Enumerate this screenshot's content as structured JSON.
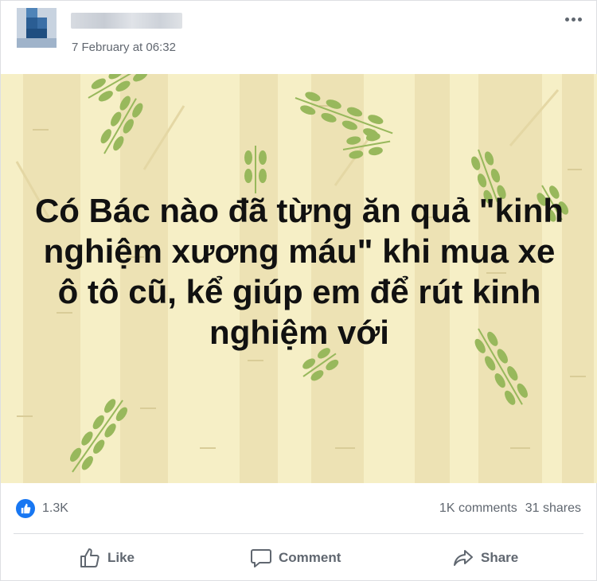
{
  "post": {
    "timestamp": "7 February at 06:32",
    "text": "Có Bác nào đã từng ăn quả \"kinh nghiệm xương máu\" khi mua xe ô tô cũ, kể giúp em để rút kinh nghiệm với",
    "background_color": "#f6efc6"
  },
  "stats": {
    "reactions": "1.3K",
    "comments": "1K comments",
    "shares": "31 shares",
    "reaction_color": "#1877f2"
  },
  "actions": {
    "like_label": "Like",
    "comment_label": "Comment",
    "share_label": "Share"
  },
  "icons": {
    "more": "more-horizontal-icon",
    "like_reaction": "like-reaction-icon",
    "like": "thumbs-up-icon",
    "comment": "comment-icon",
    "share": "share-icon"
  }
}
